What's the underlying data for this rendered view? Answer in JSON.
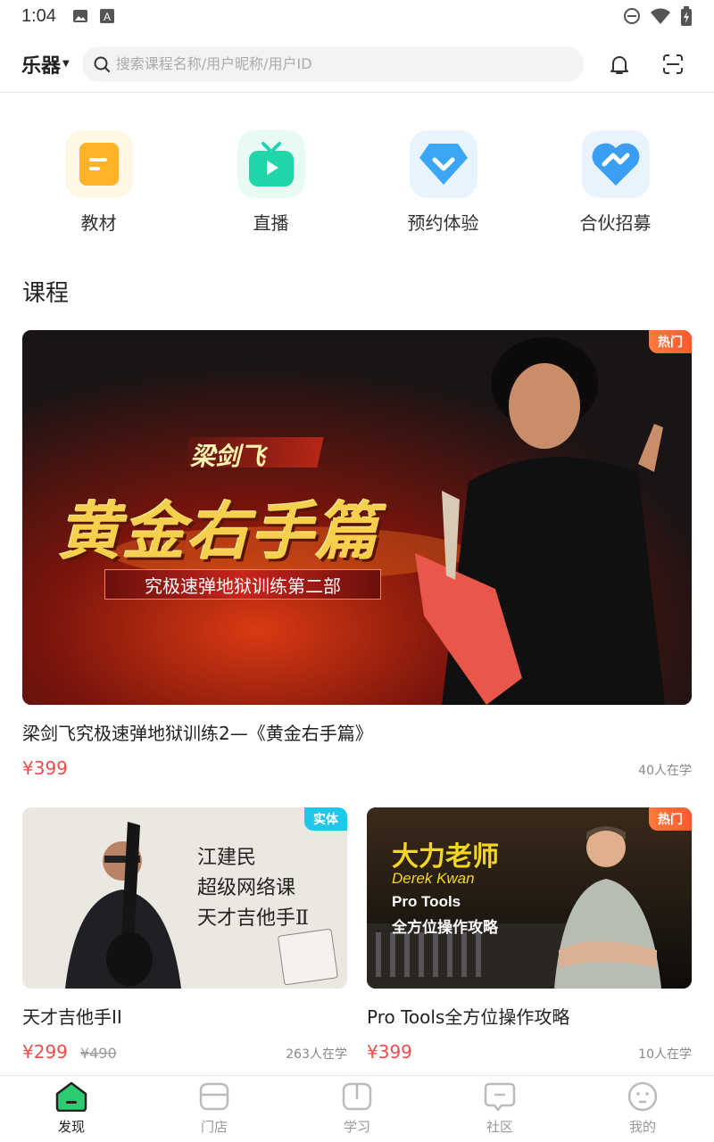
{
  "status_bar": {
    "time": "1:04"
  },
  "header": {
    "category": "乐器",
    "search_placeholder": "搜索课程名称/用户昵称/用户ID"
  },
  "quick_entries": [
    {
      "label": "教材",
      "icon": "book-icon",
      "color": "#ffb327",
      "bg": "#fff6e4"
    },
    {
      "label": "直播",
      "icon": "tv-icon",
      "color": "#1fd6a8",
      "bg": "#e7faf4"
    },
    {
      "label": "预约体验",
      "icon": "diamond-icon",
      "color": "#3aa6f5",
      "bg": "#e8f4fd"
    },
    {
      "label": "合伙招募",
      "icon": "heart-icon",
      "color": "#3a9ff3",
      "bg": "#e8f3fd"
    }
  ],
  "section": {
    "title": "课程"
  },
  "courses": [
    {
      "title": "梁剑飞究极速弹地狱训练2—《黄金右手篇》",
      "price": "¥399",
      "learners": "40人在学",
      "badge": "热门",
      "cover": {
        "name": "梁剑飞",
        "headline": "黄金右手篇",
        "subline": "究极速弹地狱训练第二部"
      }
    },
    {
      "title": "天才吉他手II",
      "price": "¥299",
      "original_price": "¥490",
      "learners": "263人在学",
      "badge": "实体",
      "cover": {
        "line1": "江建民",
        "line2": "超级网络课",
        "line3": "天才吉他手Ⅱ"
      }
    },
    {
      "title": "Pro Tools全方位操作攻略",
      "price": "¥399",
      "learners": "10人在学",
      "badge": "热门",
      "cover": {
        "line1": "大力老师",
        "line2": "Derek Kwan",
        "line3": "Pro Tools",
        "line4": "全方位操作攻略"
      }
    }
  ],
  "tabs": [
    {
      "label": "发现",
      "icon": "discover-icon",
      "active": true
    },
    {
      "label": "门店",
      "icon": "store-icon",
      "active": false
    },
    {
      "label": "学习",
      "icon": "study-icon",
      "active": false
    },
    {
      "label": "社区",
      "icon": "community-icon",
      "active": false
    },
    {
      "label": "我的",
      "icon": "profile-icon",
      "active": false
    }
  ],
  "colors": {
    "accent_green": "#2ecc71",
    "price_red": "#f04b4b",
    "hot_orange": "#ff6a35",
    "real_blue": "#1ec8e8"
  }
}
